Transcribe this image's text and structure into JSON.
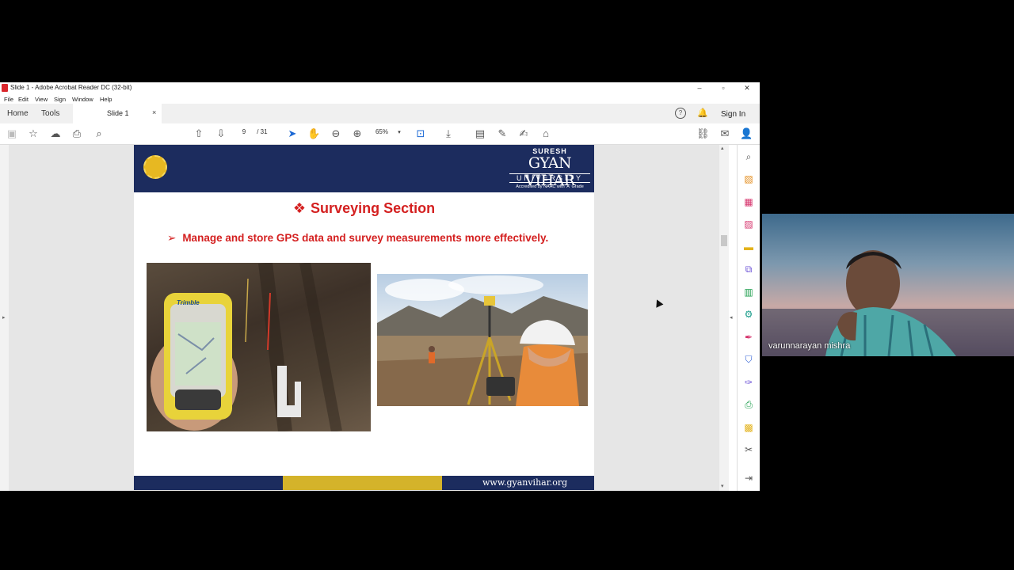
{
  "window": {
    "title": "Slide 1 - Adobe Acrobat Reader DC (32-bit)"
  },
  "menu": [
    "File",
    "Edit",
    "View",
    "Sign",
    "Window",
    "Help"
  ],
  "tabs": {
    "home": "Home",
    "tools": "Tools",
    "document": "Slide 1",
    "close": "×"
  },
  "header_right": {
    "help_icon": "?",
    "sign_in": "Sign In"
  },
  "toolbar": {
    "page_current": "9",
    "page_total": "/ 31",
    "zoom": "65%"
  },
  "slide": {
    "uni_small": "SURESH",
    "uni_big": "GYAN VIHAR",
    "uni_univ": "UNIVERSITY",
    "uni_acc": "Accredited by NAAC with 'A' Grade",
    "title_bullet": "❖",
    "title": "Surveying Section",
    "bullet_mark": "➢",
    "bullet": "Manage and store GPS data and survey measurements more  effectively.",
    "device_brand": "Trimble",
    "url": "www.gyanvihar.org"
  },
  "webcam": {
    "participant_name": "varunnarayan mishra"
  },
  "colors": {
    "header_blue": "#1c2c5e",
    "title_red": "#d42020",
    "footer_gold": "#d4b32a",
    "acrobat_blue": "#1b68d4"
  }
}
